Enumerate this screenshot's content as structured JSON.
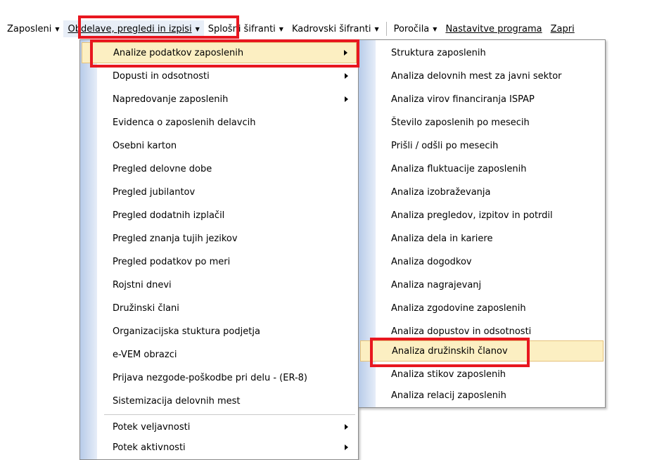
{
  "menubar": [
    {
      "label": "Zaposleni",
      "arrow": "▼"
    },
    {
      "label": "Obdelave, pregledi in izpisi",
      "arrow": "▼"
    },
    {
      "label": "Splošni šifranti",
      "arrow": "▼"
    },
    {
      "label": "Kadrovski šifranti",
      "arrow": "▼"
    },
    {
      "label": "Poročila",
      "arrow": "▼"
    },
    {
      "label": "Nastavitve programa",
      "arrow": ""
    },
    {
      "label": "Zapri",
      "arrow": ""
    }
  ],
  "menu1": {
    "items": [
      "Analize podatkov zaposlenih",
      "Dopusti in odsotnosti",
      "Napredovanje zaposlenih",
      "Evidenca o zaposlenih delavcih",
      "Osebni karton",
      "Pregled delovne dobe",
      "Pregled jubilantov",
      "Pregled dodatnih izplačil",
      "Pregled znanja tujih jezikov",
      "Pregled podatkov po meri",
      "Rojstni dnevi",
      "Družinski člani",
      "Organizacijska stuktura podjetja",
      "e-VEM obrazci",
      "Prijava nezgode-poškodbe pri delu - (ER-8)",
      "Sistemizacija delovnih mest",
      "Potek veljavnosti",
      "Potek aktivnosti"
    ]
  },
  "menu2": {
    "items": [
      "Struktura zaposlenih",
      "Analiza delovnih mest za javni sektor",
      "Analiza virov financiranja ISPAP",
      "Število zaposlenih po mesecih",
      "Prišli / odšli po mesecih",
      "Analiza fluktuacije zaposlenih",
      "Analiza izobraževanja",
      "Analiza pregledov, izpitov in potrdil",
      "Analiza dela in kariere",
      "Analiza dogodkov",
      "Analiza nagrajevanj",
      "Analiza zgodovine zaposlenih",
      "Analiza dopustov in odsotnosti",
      "Analiza družinskih članov",
      "Analiza stikov zaposlenih",
      "Analiza relacij zaposlenih"
    ]
  },
  "colors": {
    "highlight": "#e8171f",
    "selected_bg": "#fcefc2",
    "gutter": "#b7cbe9"
  }
}
